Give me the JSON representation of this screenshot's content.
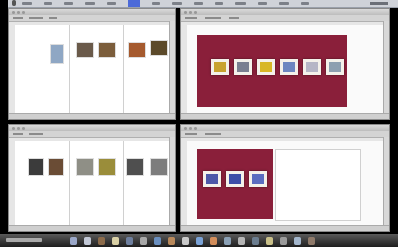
{
  "menubar": {
    "items": [
      "",
      "",
      "",
      "",
      "",
      "",
      "",
      "",
      "",
      "",
      "",
      "",
      "",
      ""
    ],
    "active_index": 5
  },
  "windows": {
    "top_left": {
      "photos": [
        {
          "color": "#8fa7c4",
          "icon": "photo"
        },
        {
          "color": "#6a5a4a",
          "icon": "photo"
        },
        {
          "color": "#7b5d3b",
          "icon": "photo"
        },
        {
          "color": "#a55a2e",
          "icon": "photo"
        },
        {
          "color": "#5c4a2a",
          "icon": "photo"
        }
      ]
    },
    "top_right": {
      "spread_color": "#8a1f3a",
      "frames": [
        {
          "color": "#c8a22e"
        },
        {
          "color": "#7a7f90"
        },
        {
          "color": "#d8b726"
        },
        {
          "color": "#6d86c0"
        },
        {
          "color": "#b6b6c6"
        },
        {
          "color": "#8d9fb0"
        }
      ]
    },
    "bottom_left": {
      "photos": [
        {
          "color": "#3b3b3b"
        },
        {
          "color": "#6a4c35"
        },
        {
          "color": "#8f8f86"
        },
        {
          "color": "#9a8d3a"
        },
        {
          "color": "#4f4f4f"
        },
        {
          "color": "#7d7d7d"
        }
      ]
    },
    "bottom_right": {
      "spread_color": "#8a1f3a",
      "frames": [
        {
          "color": "#4d58a8"
        },
        {
          "color": "#3d4ea8"
        },
        {
          "color": "#5b6dc0"
        }
      ]
    }
  },
  "dock": {
    "icons": [
      "#9aa7c8",
      "#c2c8d6",
      "#8c6b4a",
      "#d9d0a5",
      "#6e7f9e",
      "#a8a8a8",
      "#6a8fbf",
      "#b8885a",
      "#c9c9c9",
      "#7aa2d6",
      "#d28d5a",
      "#8aa0b5",
      "#b5b5b5",
      "#6b7d8f",
      "#c9c089",
      "#9b9b9b",
      "#a3b6cc",
      "#8f7a6a"
    ]
  }
}
